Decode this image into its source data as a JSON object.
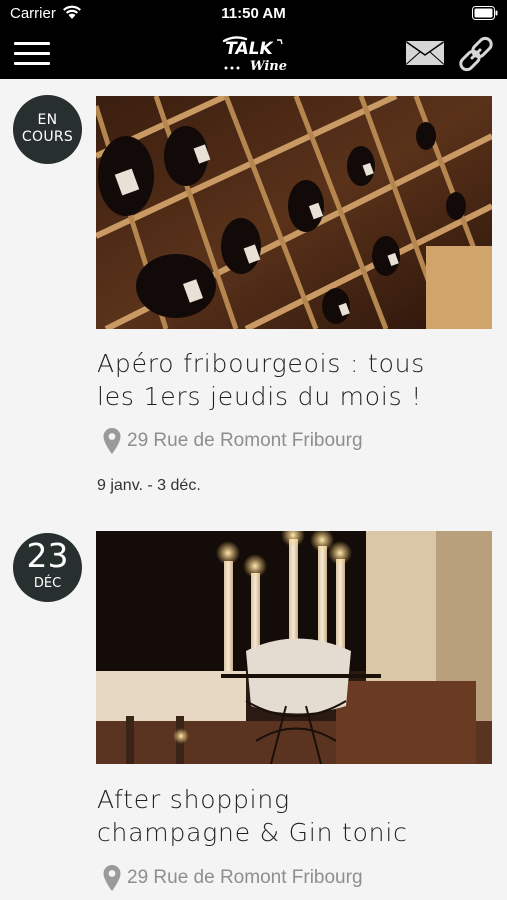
{
  "status_bar": {
    "carrier": "Carrier",
    "time": "11:50 AM",
    "icons": [
      "wifi-icon",
      "battery-icon"
    ]
  },
  "nav": {
    "logo_text_top": "TALK",
    "logo_text_bottom": "Wine",
    "icons": [
      "menu-icon",
      "mail-icon",
      "link-icon"
    ]
  },
  "events": [
    {
      "badge_line1": "EN",
      "badge_line2": "COURS",
      "image": "wine-cellar-photo",
      "title_line1": "Apéro fribourgeois : tous",
      "title_line2": "les 1ers jeudis du mois !",
      "location": "29 Rue de Romont Fribourg",
      "dates": "9 janv. - 3 déc."
    },
    {
      "badge_day": "23",
      "badge_month": "DÉC",
      "image": "candles-photo",
      "title_line1": "After shopping",
      "title_line2": "champagne & Gin tonic",
      "location": "29 Rue de Romont Fribourg"
    }
  ],
  "colors": {
    "bar_background": "#000000",
    "page_background": "#f4f4f4",
    "badge_background": "#28302f",
    "location_text": "#8e8e8e"
  }
}
